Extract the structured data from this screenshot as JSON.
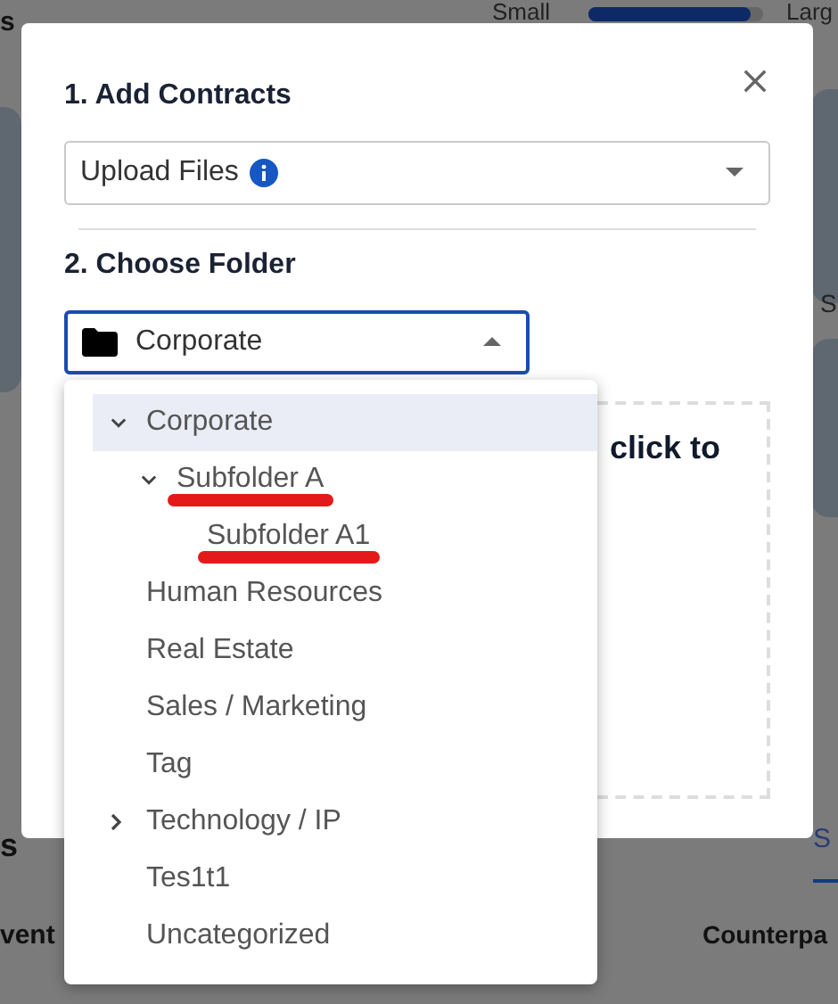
{
  "background_page": {
    "heading_fragment": "s",
    "size_slider": {
      "min_label": "Small",
      "max_label": "Larg",
      "level": 0.93
    },
    "side_label": "S",
    "section_fragment": "s",
    "tab_fragment": "S",
    "columns": [
      "vent",
      "Counterpa"
    ]
  },
  "dialog": {
    "section_1_title": "1. Add Contracts",
    "add_select": {
      "value": "Upload Files",
      "info": true
    },
    "section_2_title": "2. Choose Folder",
    "folder_select": {
      "value": "Corporate",
      "open": true
    },
    "dropzone_text": "click to",
    "folder_tree": [
      {
        "label": "Corporate",
        "kind": "branch",
        "selected": true,
        "expanded": true,
        "underlined": false,
        "children": [
          {
            "label": "Subfolder A",
            "kind": "branch",
            "selected": false,
            "expanded": true,
            "underlined": true,
            "children": [
              {
                "label": "Subfolder A1",
                "kind": "leaf",
                "selected": false,
                "underlined": true
              }
            ]
          }
        ]
      },
      {
        "label": "Human Resources",
        "kind": "leaf",
        "selected": false,
        "underlined": false
      },
      {
        "label": "Real Estate",
        "kind": "leaf",
        "selected": false,
        "underlined": false
      },
      {
        "label": "Sales / Marketing",
        "kind": "leaf",
        "selected": false,
        "underlined": false
      },
      {
        "label": "Tag",
        "kind": "leaf",
        "selected": false,
        "underlined": false
      },
      {
        "label": "Technology / IP",
        "kind": "branch",
        "selected": false,
        "expanded": false,
        "underlined": false
      },
      {
        "label": "Tes1t1",
        "kind": "leaf",
        "selected": false,
        "underlined": false
      },
      {
        "label": "Uncategorized",
        "kind": "leaf",
        "selected": false,
        "underlined": false
      }
    ]
  }
}
